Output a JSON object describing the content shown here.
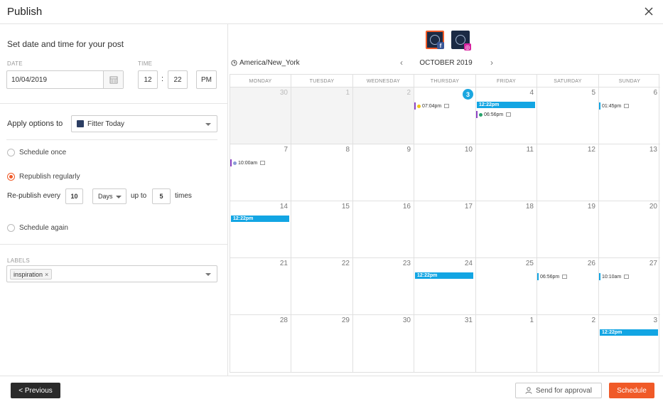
{
  "header": {
    "title": "Publish"
  },
  "left": {
    "heading": "Set date and time for your post",
    "date_label": "DATE",
    "date_value": "10/04/2019",
    "time_label": "TIME",
    "hour": "12",
    "time_sep": ":",
    "minute": "22",
    "ampm": "PM",
    "apply_label": "Apply options to",
    "apply_value": "Fitter Today",
    "schedule_once": "Schedule once",
    "republish": "Republish regularly",
    "rep_every": "Re-publish every",
    "rep_interval": "10",
    "rep_unit": "Days",
    "rep_upto": "up to",
    "rep_times_val": "5",
    "rep_times": "times",
    "schedule_again": "Schedule again",
    "labels_label": "LABELS",
    "tag": "inspiration",
    "tag_remove": "×"
  },
  "calendar": {
    "timezone": "America/New_York",
    "month": "OCTOBER 2019",
    "prev": "‹",
    "next": "›",
    "days": [
      "MONDAY",
      "TUESDAY",
      "WEDNESDAY",
      "THURSDAY",
      "FRIDAY",
      "SATURDAY",
      "SUNDAY"
    ],
    "weeks": [
      [
        "30",
        "1",
        "2",
        "3",
        "4",
        "5",
        "6"
      ],
      [
        "7",
        "8",
        "9",
        "10",
        "11",
        "12",
        "13"
      ],
      [
        "14",
        "15",
        "16",
        "17",
        "18",
        "19",
        "20"
      ],
      [
        "21",
        "22",
        "23",
        "24",
        "25",
        "26",
        "27"
      ],
      [
        "28",
        "29",
        "30",
        "31",
        "1",
        "2",
        "3"
      ]
    ],
    "events": {
      "thu3": "07:04pm",
      "fri4_bar": "12:22pm",
      "fri4_mini": "06:56pm",
      "sun6": "01:45pm",
      "mon7": "10:00am",
      "mon14": "12:22pm",
      "thu24": "12:22pm",
      "sat26": "06:56pm",
      "sun27": "10:10am",
      "sun3": "12:22pm"
    },
    "colors": {
      "accent": "#12a5e3",
      "purple": "#8e44c4",
      "yellow": "#f0c419",
      "green": "#27a36b"
    }
  },
  "footer": {
    "previous": "< Previous",
    "approval": "Send for approval",
    "schedule": "Schedule"
  }
}
